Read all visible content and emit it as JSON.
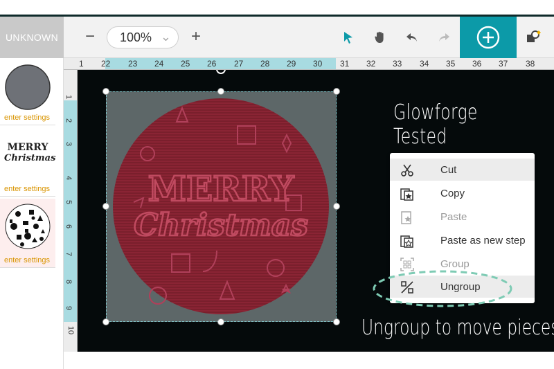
{
  "sidebar_header": "UNKNOWN",
  "zoom": {
    "value": "100%",
    "minus": "−",
    "plus": "+",
    "chevron": "⌄"
  },
  "toolbar_icons": [
    "select-arrow-icon",
    "hand-pan-icon",
    "undo-icon",
    "redo-icon",
    "add-icon",
    "shape-icon"
  ],
  "ruler_top": [
    "1",
    "22",
    "23",
    "24",
    "25",
    "26",
    "27",
    "28",
    "29",
    "30",
    "31",
    "32",
    "33",
    "34",
    "35",
    "36",
    "37",
    "38"
  ],
  "ruler_left": [
    "1",
    "2",
    "3",
    "4",
    "5",
    "6",
    "7",
    "8",
    "9",
    "10"
  ],
  "thumbnails": [
    {
      "kind": "circle",
      "settings": "enter settings"
    },
    {
      "kind": "merry-christmas-text",
      "settings": "enter settings",
      "art_lines": [
        "MERRY",
        "Christmas"
      ]
    },
    {
      "kind": "ornament-pattern",
      "settings": "enter settings"
    }
  ],
  "design_art": {
    "line1": "MERRY",
    "line2": "Christmas"
  },
  "overlay": {
    "title": "Glowforge Tested",
    "caption": "Ungroup to move pieces"
  },
  "context_menu": [
    {
      "label": "Cut",
      "icon": "scissors-icon",
      "enabled": true,
      "highlighted": true
    },
    {
      "label": "Copy",
      "icon": "copy-icon",
      "enabled": true
    },
    {
      "label": "Paste",
      "icon": "paste-icon",
      "enabled": false
    },
    {
      "label": "Paste as new step",
      "icon": "paste-new-step-icon",
      "enabled": true
    },
    {
      "label": "Group",
      "icon": "group-icon",
      "enabled": false
    },
    {
      "label": "Ungroup",
      "icon": "ungroup-icon",
      "enabled": true,
      "highlighted": true
    }
  ],
  "colors": {
    "accent": "#0c9aa8",
    "canvas": "#050a0b",
    "engrave": "#8a1d2e",
    "settings_text": "#d99400",
    "annotation": "#7ecbb4"
  }
}
